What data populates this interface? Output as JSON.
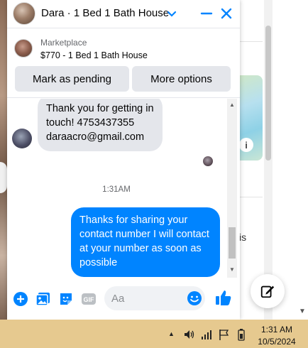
{
  "chat": {
    "title": "Dara · 1 Bed 1 Bath House",
    "listing": {
      "source": "Marketplace",
      "title": "$770 - 1 Bed 1 Bath House",
      "mark_pending_label": "Mark as pending",
      "more_options_label": "More options"
    },
    "messages": {
      "incoming_text": "Thank you for getting in touch! 4753437355 daraacro@gmail.com",
      "timestamp": "1:31AM",
      "outgoing_text": "Thanks for sharing your contact number I will contact at your number as soon as possible"
    },
    "composer": {
      "placeholder": "Aa",
      "icons": [
        "plus-circle-icon",
        "photo-icon",
        "sticker-icon",
        "gif-icon",
        "emoji-icon",
        "thumbs-up-icon"
      ]
    }
  },
  "background_page": {
    "fragment_text": "is"
  },
  "taskbar": {
    "time": "1:31 AM",
    "date": "10/5/2024",
    "tray_icons": [
      "show-hidden-icons-chevron",
      "volume-icon",
      "network-icon",
      "flag-icon",
      "battery-icon"
    ]
  },
  "colors": {
    "accent": "#0084ff",
    "incoming_bubble": "#e4e6eb",
    "taskbar": "#e6c98f"
  }
}
